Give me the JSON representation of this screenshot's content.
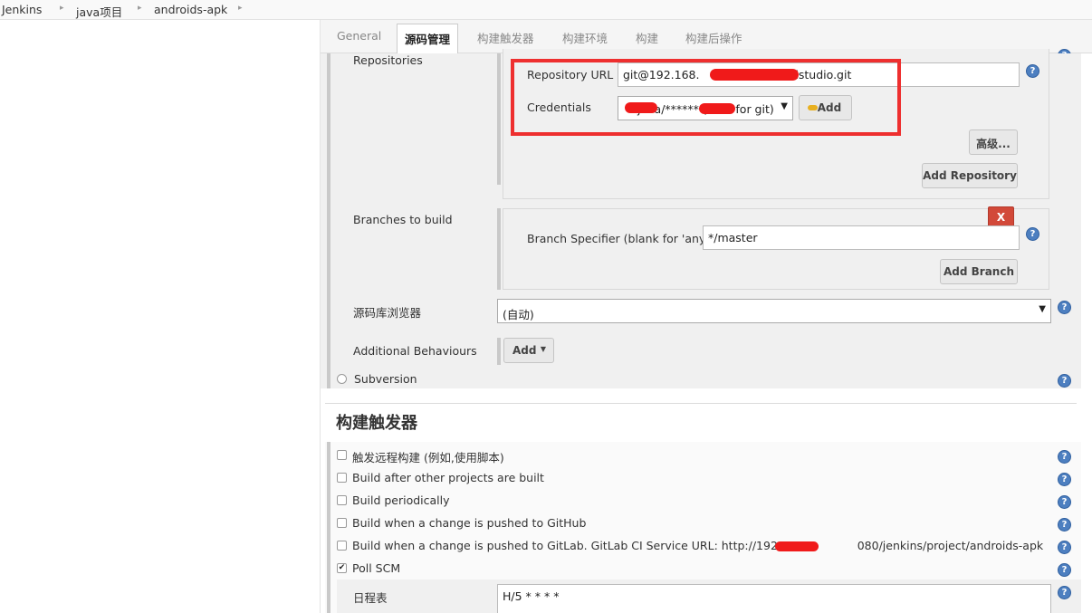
{
  "breadcrumb": [
    "Jenkins",
    "java项目",
    "androids-apk"
  ],
  "tabs": [
    "General",
    "源码管理",
    "构建触发器",
    "构建环境",
    "构建",
    "构建后操作"
  ],
  "active_tab": "源码管理",
  "scm": {
    "repositories_label": "Repositories",
    "repository_url_label": "Repository URL",
    "repository_url_value": "git@192.168.",
    "repository_url_tail": "idstudio.git",
    "credentials_label": "Credentials",
    "credentials_value": "java/****** (",
    "credentials_tail": "a for git)",
    "add_credentials_button": "Add",
    "advanced_button": "高级...",
    "add_repository_button": "Add Repository",
    "branches_label": "Branches to build",
    "delete_branch_button": "X",
    "branch_specifier_label": "Branch Specifier (blank for 'any')",
    "branch_specifier_value": "*/master",
    "add_branch_button": "Add Branch",
    "repo_browser_label": "源码库浏览器",
    "repo_browser_value": "(自动)",
    "additional_behaviours_label": "Additional Behaviours",
    "add_behaviour_button": "Add",
    "subversion_label": "Subversion"
  },
  "triggers": {
    "heading": "构建触发器",
    "items": [
      {
        "label": "触发远程构建 (例如,使用脚本)",
        "checked": false
      },
      {
        "label": "Build after other projects are built",
        "checked": false
      },
      {
        "label": "Build periodically",
        "checked": false
      },
      {
        "label": "Build when a change is pushed to GitHub",
        "checked": false
      },
      {
        "label": "Build when a change is pushed to GitLab. GitLab CI Service URL: http://192.168.",
        "label_tail": "080/jenkins/project/androids-apk",
        "checked": false
      },
      {
        "label": "Poll SCM",
        "checked": true
      }
    ],
    "schedule_label": "日程表",
    "schedule_value": "H/5 * * * *"
  },
  "colors": {
    "highlight": "#ee2f2f",
    "redaction": "#f01a1a",
    "help_icon": "#4d7fc0",
    "delete_button": "#d24939"
  }
}
